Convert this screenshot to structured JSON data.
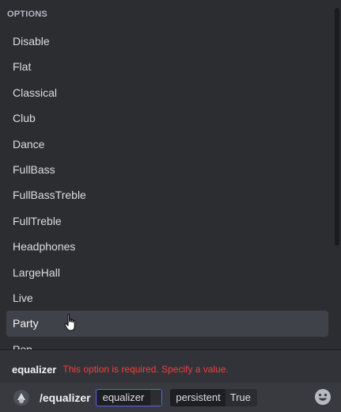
{
  "popup": {
    "header": "OPTIONS",
    "options": [
      {
        "label": "Disable"
      },
      {
        "label": "Flat"
      },
      {
        "label": "Classical"
      },
      {
        "label": "Club"
      },
      {
        "label": "Dance"
      },
      {
        "label": "FullBass"
      },
      {
        "label": "FullBassTreble"
      },
      {
        "label": "FullTreble"
      },
      {
        "label": "Headphones"
      },
      {
        "label": "LargeHall"
      },
      {
        "label": "Live"
      },
      {
        "label": "Party"
      },
      {
        "label": "Pop"
      }
    ],
    "hovered_option": "Party"
  },
  "hint": {
    "option_name": "equalizer",
    "error": "This option is required. Specify a value."
  },
  "input": {
    "command": "/equalizer",
    "active_option": "equalizer",
    "other_option_name": "persistent",
    "other_option_value": "True"
  },
  "icons": {
    "app": "bot-app-icon",
    "emoji": "emoji-smile-icon",
    "cursor": "hand-pointer-cursor"
  },
  "colors": {
    "accent": "#5865f2",
    "error": "#f23f43",
    "background": "#313338",
    "popup": "#2b2d31"
  }
}
